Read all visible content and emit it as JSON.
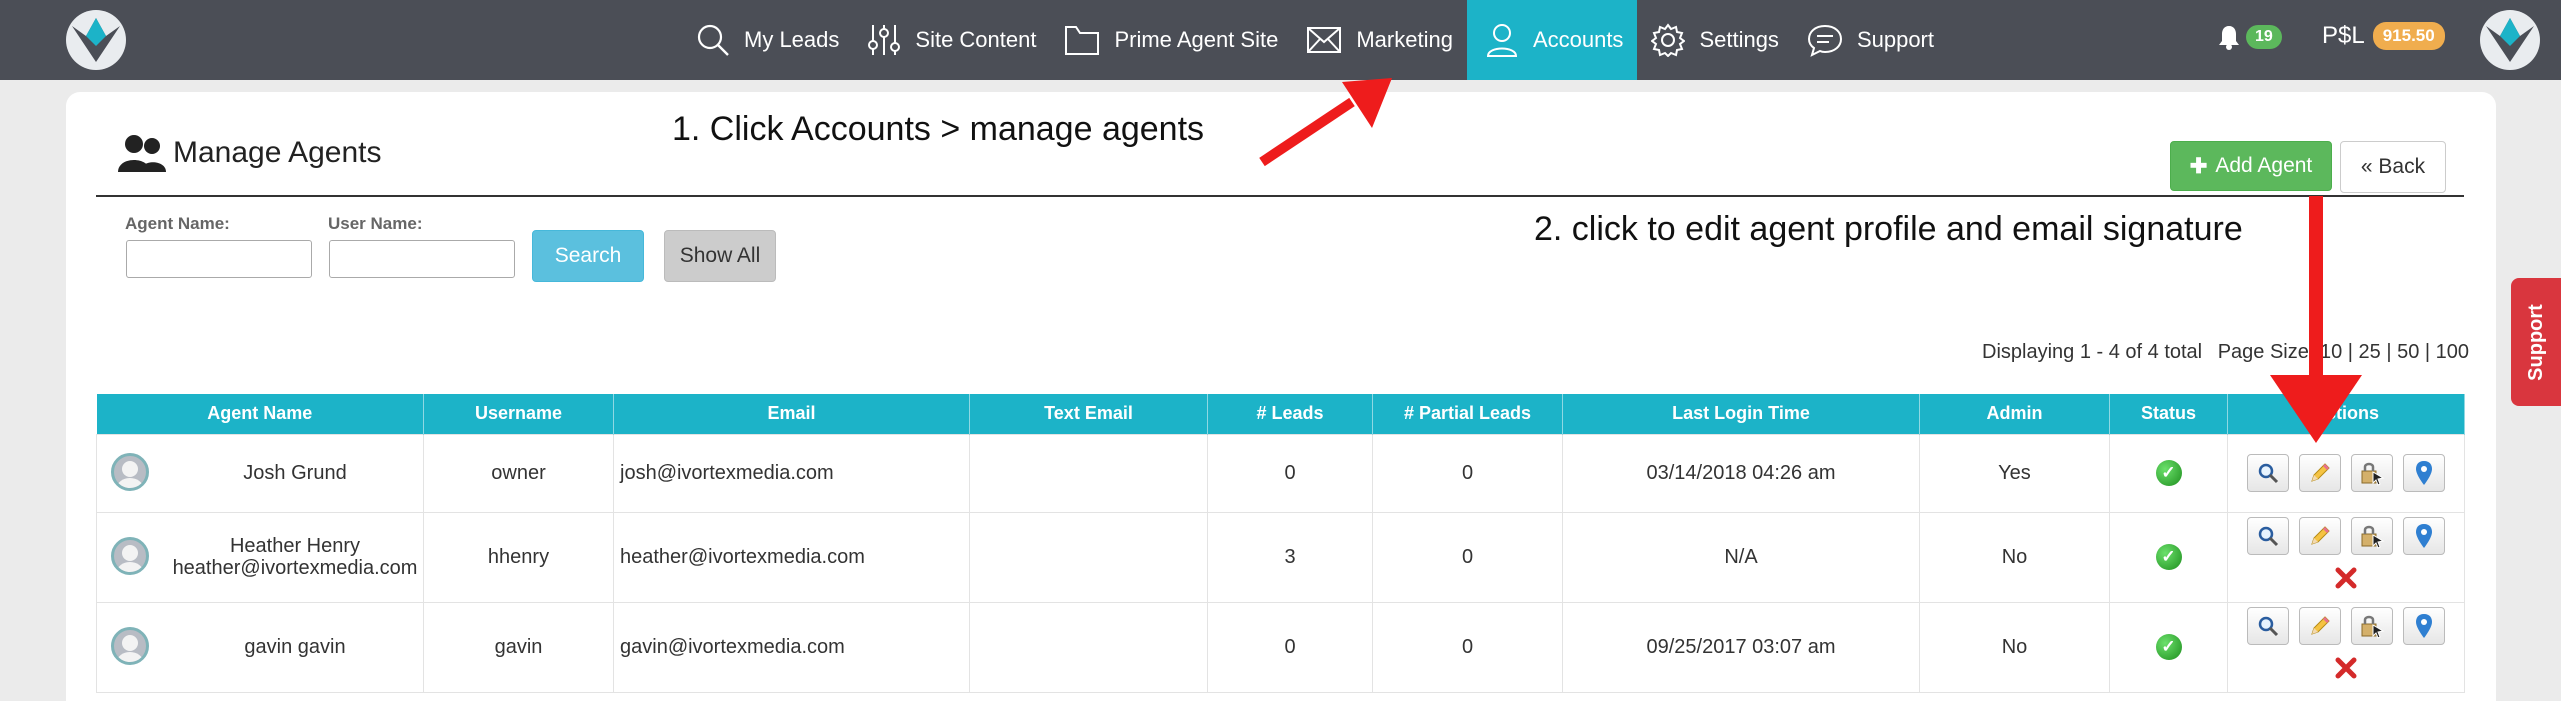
{
  "nav": {
    "items": [
      {
        "label": "My Leads",
        "icon": "search-icon"
      },
      {
        "label": "Site Content",
        "icon": "sliders-icon"
      },
      {
        "label": "Prime Agent Site",
        "icon": "folder-icon"
      },
      {
        "label": "Marketing",
        "icon": "envelope-icon"
      },
      {
        "label": "Accounts",
        "icon": "user-icon",
        "active": true
      },
      {
        "label": "Settings",
        "icon": "gear-icon"
      },
      {
        "label": "Support",
        "icon": "chat-icon"
      }
    ],
    "notification_count": "19",
    "points_label": "P$L",
    "points_value": "915.50",
    "colors": {
      "bar": "#4b4e56",
      "active": "#1cb3c8"
    }
  },
  "page": {
    "title": "Manage Agents",
    "add_button": "Add Agent",
    "back_button": "« Back"
  },
  "filters": {
    "agent_name_label": "Agent Name:",
    "user_name_label": "User Name:",
    "agent_name_value": "",
    "user_name_value": "",
    "search_button": "Search",
    "show_all_button": "Show All"
  },
  "paging": {
    "display_text": "Displaying 1 - 4 of 4 total",
    "page_size_label": "Page Size:",
    "sizes": [
      "10",
      "25",
      "50",
      "100"
    ]
  },
  "table": {
    "headers": [
      "Agent Name",
      "Username",
      "Email",
      "Text Email",
      "# Leads",
      "# Partial Leads",
      "Last Login Time",
      "Admin",
      "Status",
      "Actions"
    ],
    "rows": [
      {
        "name": "Josh Grund",
        "username": "owner",
        "email": "josh@ivortexmedia.com",
        "text_email": "",
        "leads": "0",
        "partial": "0",
        "last_login": "03/14/2018 04:26 am",
        "admin": "Yes",
        "status": "active",
        "deletable": false
      },
      {
        "name": "Heather Henry",
        "name_sub": "heather@ivortexmedia.com",
        "username": "hhenry",
        "email": "heather@ivortexmedia.com",
        "text_email": "",
        "leads": "3",
        "partial": "0",
        "last_login": "N/A",
        "admin": "No",
        "status": "active",
        "deletable": true
      },
      {
        "name": "gavin gavin",
        "username": "gavin",
        "email": "gavin@ivortexmedia.com",
        "text_email": "",
        "leads": "0",
        "partial": "0",
        "last_login": "09/25/2017 03:07 am",
        "admin": "No",
        "status": "active",
        "deletable": true
      }
    ]
  },
  "annotations": {
    "step1": "1. Click Accounts > manage agents",
    "step2": "2. click to edit agent profile and email signature"
  },
  "support_tab": "Support"
}
